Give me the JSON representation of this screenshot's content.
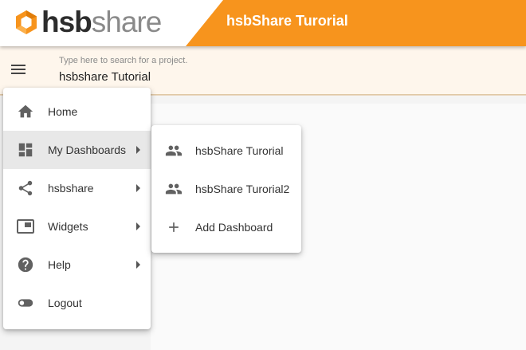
{
  "header": {
    "logo_text_bold": "hsb",
    "logo_text_light": "share",
    "title": "hsbShare Turorial"
  },
  "search": {
    "placeholder": "Type here to search for a project.",
    "value": "hsbshare Tutorial"
  },
  "main_menu": {
    "items": [
      {
        "label": "Home",
        "icon": "home-icon",
        "has_submenu": false
      },
      {
        "label": "My Dashboards",
        "icon": "dashboard-icon",
        "has_submenu": true,
        "active": true
      },
      {
        "label": "hsbshare",
        "icon": "share-icon",
        "has_submenu": true
      },
      {
        "label": "Widgets",
        "icon": "widgets-icon",
        "has_submenu": true
      },
      {
        "label": "Help",
        "icon": "help-icon",
        "has_submenu": true
      },
      {
        "label": "Logout",
        "icon": "toggle-icon",
        "has_submenu": false
      }
    ]
  },
  "dashboards_menu": {
    "items": [
      {
        "label": "hsbShare Turorial",
        "icon": "people-icon"
      },
      {
        "label": "hsbShare Turorial2",
        "icon": "people-icon"
      },
      {
        "label": "Add Dashboard",
        "icon": "plus-icon"
      }
    ]
  },
  "colors": {
    "brand_orange": "#f7941d",
    "logo_orange": "#f7941d",
    "logo_dark": "#2c2c2c",
    "logo_grey": "#8a8a8a"
  }
}
